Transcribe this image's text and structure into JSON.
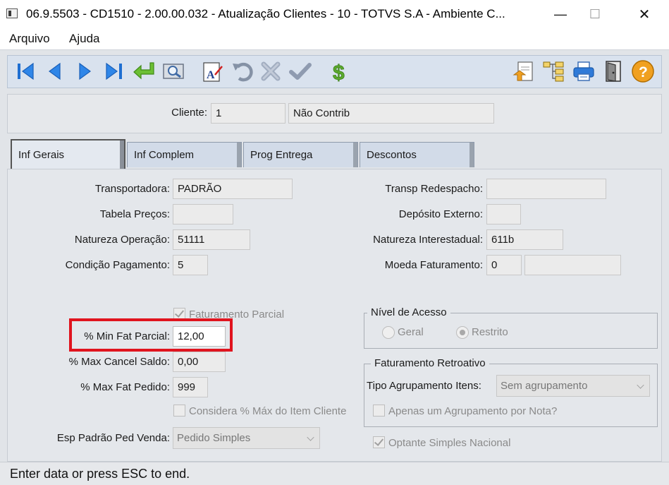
{
  "window": {
    "title": "06.9.5503 - CD1510 - 2.00.00.032 - Atualização Clientes - 10 - TOTVS S.A - Ambiente C...",
    "minimize": "—",
    "maximize": "☐",
    "close": "✕"
  },
  "menu": {
    "items": [
      "Arquivo",
      "Ajuda"
    ]
  },
  "toolbar": {
    "buttons": [
      "first-record-icon",
      "previous-record-icon",
      "next-record-icon",
      "last-record-icon",
      "goto-icon",
      "search-icon",
      "edit-text-icon",
      "undo-icon",
      "cancel-icon",
      "confirm-icon",
      "currency-icon",
      "export-icon",
      "tree-icon",
      "print-icon",
      "exit-icon",
      "help-icon"
    ],
    "colors": {
      "nav": "#1f6fd1",
      "green": "#5ba92d",
      "gray": "#8a96a8",
      "help": "#f0a020"
    }
  },
  "header": {
    "cliente_label": "Cliente:",
    "cliente_code": "1",
    "cliente_name": "Não Contrib"
  },
  "tabs": [
    "Inf Gerais",
    "Inf Complem",
    "Prog Entrega",
    "Descontos"
  ],
  "left": {
    "transportadora_label": "Transportadora:",
    "transportadora_value": "PADRÃO",
    "tabela_label": "Tabela Preços:",
    "tabela_value": "",
    "natureza_label": "Natureza Operação:",
    "natureza_value": "51111",
    "condicao_label": "Condição Pagamento:",
    "condicao_value": "5",
    "fat_parcial_label": "Faturamento Parcial",
    "fat_parcial_checked": true,
    "min_fat_label": "% Min Fat Parcial:",
    "min_fat_value": "12,00",
    "max_cancel_label": "% Max Cancel Saldo:",
    "max_cancel_value": "0,00",
    "max_fat_label": "% Max Fat Pedido:",
    "max_fat_value": "999",
    "considera_label": "Considera % Máx do Item Cliente",
    "considera_checked": false,
    "esp_padrao_label": "Esp Padrão Ped Venda:",
    "esp_padrao_value": "Pedido Simples"
  },
  "right": {
    "redespacho_label": "Transp Redespacho:",
    "redespacho_value": "",
    "deposito_label": "Depósito Externo:",
    "deposito_value": "",
    "nat_interestadual_label": "Natureza Interestadual:",
    "nat_interestadual_value": "611b",
    "moeda_label": "Moeda Faturamento:",
    "moeda_value": "0",
    "moeda_desc": "",
    "nivel_acesso_title": "Nível de Acesso",
    "geral_label": "Geral",
    "restrito_label": "Restrito",
    "selected_access": "Restrito",
    "retroativo_title": "Faturamento Retroativo",
    "tipo_agrup_label": "Tipo Agrupamento Itens:",
    "tipo_agrup_value": "Sem agrupamento",
    "apenas_label": "Apenas um Agrupamento por Nota?",
    "apenas_checked": false,
    "optante_label": "Optante Simples Nacional",
    "optante_checked": true
  },
  "status": {
    "text": "Enter data or press ESC to end."
  }
}
